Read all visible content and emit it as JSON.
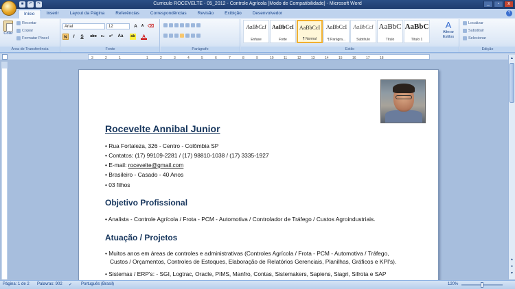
{
  "window": {
    "title": "Curriculo ROCEVELTE - 05_2012 - Controle Agrícola [Modo de Compatibilidade] - Microsoft Word",
    "controls": [
      "_",
      "▫",
      "x"
    ]
  },
  "tabs": [
    "Início",
    "Inserir",
    "Layout da Página",
    "Referências",
    "Correspondências",
    "Revisão",
    "Exibição",
    "Desenvolvedor"
  ],
  "ribbon": {
    "clipboard": {
      "paste": "Colar",
      "cut": "Recortar",
      "copy": "Copiar",
      "painter": "Formatar Pincel",
      "label": "Área de Transferência"
    },
    "font": {
      "name": "Arial",
      "size": "12",
      "label": "Fonte",
      "buttons": [
        "N",
        "I",
        "S",
        "abc",
        "x₂",
        "x²",
        "Aa",
        "ab",
        "A"
      ]
    },
    "paragraph": {
      "label": "Parágrafo"
    },
    "styles": {
      "label": "Estilo",
      "items": [
        {
          "preview": "AaBbCcI",
          "name": "Ênfase"
        },
        {
          "preview": "AaBbCcI",
          "name": "Forte"
        },
        {
          "preview": "AaBbCcI",
          "name": "¶ Normal"
        },
        {
          "preview": "AaBbCcI",
          "name": "¶ Parágra..."
        },
        {
          "preview": "AaBbCcI",
          "name": "Subtítulo"
        },
        {
          "preview": "AaBbC",
          "name": "Título"
        },
        {
          "preview": "AaBbC",
          "name": "Título 1"
        }
      ],
      "change": "Alterar Estilos"
    },
    "editing": {
      "find": "Localizar",
      "replace": "Substituir",
      "select": "Selecionar",
      "label": "Edição"
    }
  },
  "ruler": {
    "ticks": [
      "3",
      "2",
      "1",
      "1",
      "2",
      "3",
      "4",
      "5",
      "6",
      "7",
      "8",
      "9",
      "10",
      "11",
      "12",
      "13",
      "14",
      "15",
      "16",
      "17",
      "18"
    ]
  },
  "document": {
    "name": "Rocevelte Annibal Junior",
    "contact": [
      "Rua Fortaleza, 326 - Centro - Colômbia SP",
      "Contatos: (17) 99109-2281 / (17) 98810-1038 / (17) 3335-1927",
      "E-mail: ",
      "Brasileiro - Casado - 40 Anos",
      "03 filhos"
    ],
    "email": "rocevelte@gmail.com",
    "sec1": "Objetivo Profissional",
    "objective": "Analista - Controle Agrícola / Frota - PCM - Automotiva / Controlador de Tráfego / Custos Agroindustriais.",
    "sec2": "Atuação / Projetos",
    "proj1a": "Muitos anos em áreas de controles e administrativas (Controles Agrícola / Frota - PCM - Automotiva / Tráfego,",
    "proj1b": "Custos / Orçamentos, Controles de Estoques, Elaboração de Relatórios Gerenciais, Planilhas, Gráficos e KPI's).",
    "proj2": "Sistemas / ERP's: - SGI, Logtrac, Oracle, PIMS, Manfro, Contas, Sistemakers, Sapiens, Siagri, Sifrota e SAP"
  },
  "status": {
    "page": "Página: 1 de 2",
    "words": "Palavras: 902",
    "lang": "Português (Brasil)",
    "zoom": "120%"
  }
}
